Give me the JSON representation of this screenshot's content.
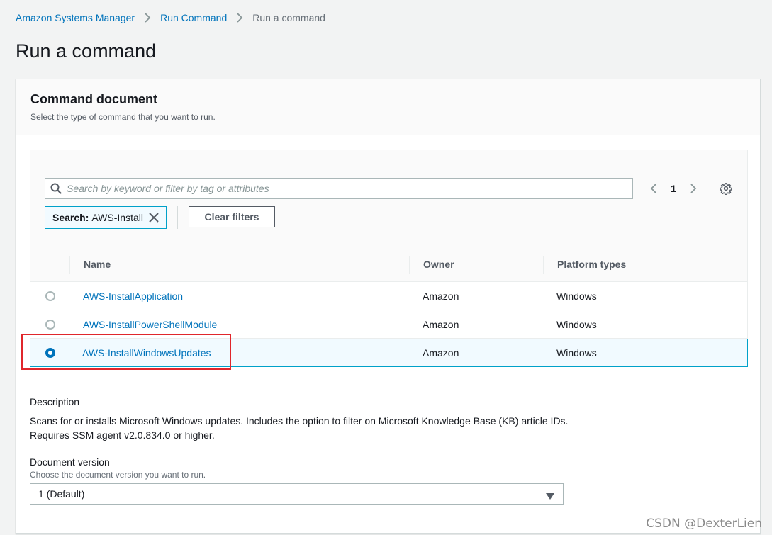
{
  "breadcrumb": {
    "items": [
      {
        "label": "Amazon Systems Manager"
      },
      {
        "label": "Run Command"
      },
      {
        "label": "Run a command"
      }
    ]
  },
  "page": {
    "title": "Run a command"
  },
  "panel": {
    "title": "Command document",
    "subtitle": "Select the type of command that you want to run."
  },
  "search": {
    "placeholder": "Search by keyword or filter by tag or attributes",
    "value": ""
  },
  "token": {
    "key": "Search:",
    "value": "AWS-Install"
  },
  "clear_filters_label": "Clear filters",
  "pagination": {
    "current_page": "1"
  },
  "table": {
    "columns": [
      "Name",
      "Owner",
      "Platform types"
    ],
    "rows": [
      {
        "name": "AWS-InstallApplication",
        "owner": "Amazon",
        "platform": "Windows",
        "selected": false
      },
      {
        "name": "AWS-InstallPowerShellModule",
        "owner": "Amazon",
        "platform": "Windows",
        "selected": false
      },
      {
        "name": "AWS-InstallWindowsUpdates",
        "owner": "Amazon",
        "platform": "Windows",
        "selected": true
      }
    ]
  },
  "description": {
    "label": "Description",
    "text": "Scans for or installs Microsoft Windows updates. Includes the option to filter on Microsoft Knowledge Base (KB) article IDs. Requires SSM agent v2.0.834.0 or higher."
  },
  "document_version": {
    "label": "Document version",
    "hint": "Choose the document version you want to run.",
    "selected": "1 (Default)"
  },
  "watermark": "CSDN @DexterLien",
  "colors": {
    "link": "#0073bb",
    "selected_row_border": "#00a1c9",
    "annotation": "#e0262b"
  },
  "icons": [
    "chevron-right-icon",
    "search-icon",
    "chevron-left-icon",
    "settings-gear-icon",
    "close-icon",
    "caret-down-icon"
  ]
}
